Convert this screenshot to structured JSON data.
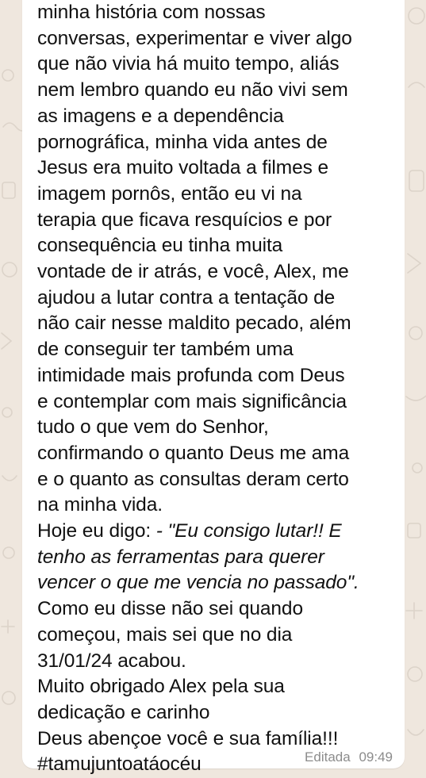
{
  "message": {
    "lines": [
      {
        "text": "minha história com nossas",
        "italic": false
      },
      {
        "text": "conversas, experimentar e viver algo",
        "italic": false
      },
      {
        "text": "que não vivia há muito tempo, aliás",
        "italic": false
      },
      {
        "text": "nem lembro quando eu não vivi sem",
        "italic": false
      },
      {
        "text": "as imagens e a dependência",
        "italic": false
      },
      {
        "text": "pornográfica, minha vida antes de",
        "italic": false
      },
      {
        "text": "Jesus era muito voltada a filmes e",
        "italic": false
      },
      {
        "text": "imagem pornôs, então eu vi na",
        "italic": false
      },
      {
        "text": "terapia que ficava resquícios e por",
        "italic": false
      },
      {
        "text": "consequência eu tinha muita",
        "italic": false
      },
      {
        "text": "vontade de ir atrás, e você, Alex, me",
        "italic": false
      },
      {
        "text": "ajudou a lutar contra a tentação de",
        "italic": false
      },
      {
        "text": "não cair nesse maldito pecado, além",
        "italic": false
      },
      {
        "text": "de conseguir ter também uma",
        "italic": false
      },
      {
        "text": "intimidade mais profunda com Deus",
        "italic": false
      },
      {
        "text": "e contemplar com mais significância",
        "italic": false
      },
      {
        "text": "tudo o que vem do Senhor,",
        "italic": false
      },
      {
        "text": "confirmando o quanto Deus me ama",
        "italic": false
      },
      {
        "text": "e o quanto as consultas deram certo",
        "italic": false
      },
      {
        "text": "na minha vida.",
        "italic": false
      },
      {
        "text": "Hoje eu digo: - \"Eu consigo lutar!! E",
        "italic": false,
        "italic_from": 14
      },
      {
        "text": "tenho as ferramentas para querer",
        "italic": true
      },
      {
        "text": "vencer o que me vencia no passado\".",
        "italic": true
      },
      {
        "text": "Como eu disse não sei quando",
        "italic": false
      },
      {
        "text": "começou, mais sei que no dia",
        "italic": false
      },
      {
        "text": "31/01/24 acabou.",
        "italic": false
      },
      {
        "text": "Muito obrigado Alex pela sua",
        "italic": false
      },
      {
        "text": "dedicação e carinho",
        "italic": false
      },
      {
        "text": "Deus abençoe você e sua família!!!",
        "italic": false
      },
      {
        "text": "#tamujuntoatáocéu",
        "italic": false
      }
    ],
    "edited_label": "Editada",
    "time": "09:49"
  },
  "colors": {
    "wallpaper": "#efe7de",
    "bubble": "#ffffff",
    "text": "#111111",
    "meta": "#8c8c8c"
  }
}
